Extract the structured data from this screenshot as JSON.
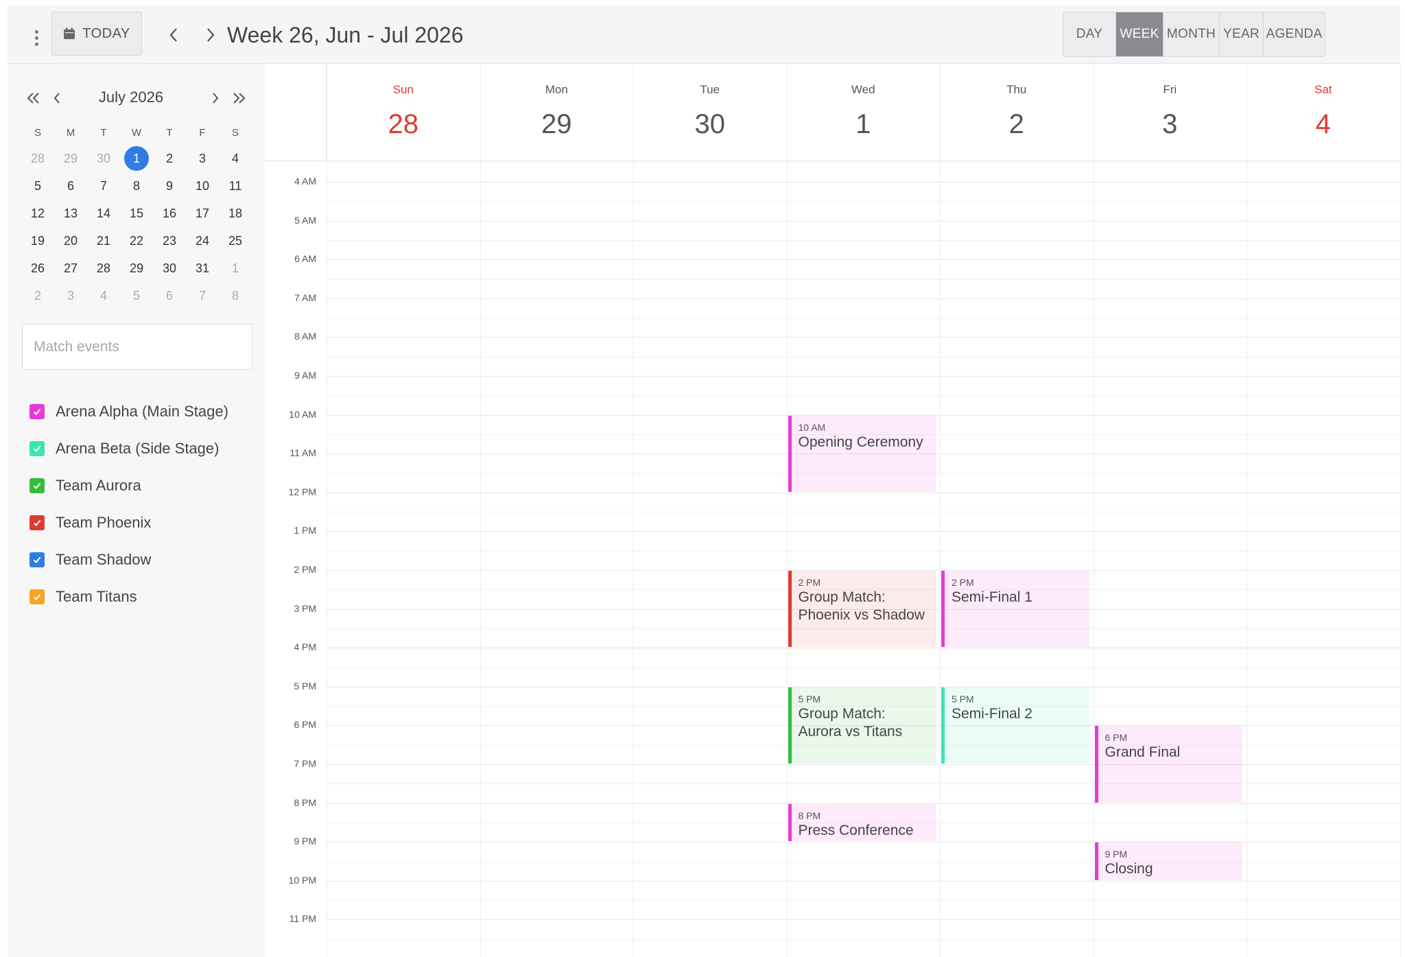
{
  "toolbar": {
    "today_label": "TODAY",
    "week_title": "Week 26, Jun - Jul 2026",
    "views": [
      "DAY",
      "WEEK",
      "MONTH",
      "YEAR",
      "AGENDA"
    ],
    "active_view": "WEEK"
  },
  "mini_calendar": {
    "title": "July 2026",
    "dow": [
      "S",
      "M",
      "T",
      "W",
      "T",
      "F",
      "S"
    ],
    "weeks": [
      [
        "28",
        "29",
        "30",
        "1",
        "2",
        "3",
        "4"
      ],
      [
        "5",
        "6",
        "7",
        "8",
        "9",
        "10",
        "11"
      ],
      [
        "12",
        "13",
        "14",
        "15",
        "16",
        "17",
        "18"
      ],
      [
        "19",
        "20",
        "21",
        "22",
        "23",
        "24",
        "25"
      ],
      [
        "26",
        "27",
        "28",
        "29",
        "30",
        "31",
        "1"
      ],
      [
        "2",
        "3",
        "4",
        "5",
        "6",
        "7",
        "8"
      ]
    ],
    "selected": "1"
  },
  "search": {
    "placeholder": "Match events"
  },
  "calendars": [
    {
      "name": "Arena Alpha (Main Stage)",
      "color": "#e83ad6"
    },
    {
      "name": "Arena Beta (Side Stage)",
      "color": "#3de3b0"
    },
    {
      "name": "Team Aurora",
      "color": "#2fbf3a"
    },
    {
      "name": "Team Phoenix",
      "color": "#e03a2f"
    },
    {
      "name": "Team Shadow",
      "color": "#2f7de1"
    },
    {
      "name": "Team Titans",
      "color": "#f5a623"
    }
  ],
  "days": [
    {
      "name": "Sun",
      "num": "28",
      "weekend": true
    },
    {
      "name": "Mon",
      "num": "29",
      "weekend": false
    },
    {
      "name": "Tue",
      "num": "30",
      "weekend": false
    },
    {
      "name": "Wed",
      "num": "1",
      "weekend": false
    },
    {
      "name": "Thu",
      "num": "2",
      "weekend": false
    },
    {
      "name": "Fri",
      "num": "3",
      "weekend": false
    },
    {
      "name": "Sat",
      "num": "4",
      "weekend": true
    }
  ],
  "hours": [
    "4 AM",
    "5 AM",
    "6 AM",
    "7 AM",
    "8 AM",
    "9 AM",
    "10 AM",
    "11 AM",
    "12 PM",
    "1 PM",
    "2 PM",
    "3 PM",
    "4 PM",
    "5 PM",
    "6 PM",
    "7 PM",
    "8 PM",
    "9 PM",
    "10 PM",
    "11 PM"
  ],
  "events": [
    {
      "day": 3,
      "start": 10,
      "end": 12,
      "time": "10 AM",
      "title": "Opening Ceremony",
      "calendar": 0
    },
    {
      "day": 3,
      "start": 14,
      "end": 16,
      "time": "2 PM",
      "title": "Group Match: Phoenix vs Shadow",
      "calendar": 3
    },
    {
      "day": 4,
      "start": 14,
      "end": 16,
      "time": "2 PM",
      "title": "Semi-Final 1",
      "calendar": 0
    },
    {
      "day": 3,
      "start": 17,
      "end": 19,
      "time": "5 PM",
      "title": "Group Match: Aurora vs Titans",
      "calendar": 2
    },
    {
      "day": 4,
      "start": 17,
      "end": 19,
      "time": "5 PM",
      "title": "Semi-Final 2",
      "calendar": 1
    },
    {
      "day": 5,
      "start": 18,
      "end": 20,
      "time": "6 PM",
      "title": "Grand Final",
      "calendar": 0
    },
    {
      "day": 3,
      "start": 20,
      "end": 21,
      "time": "8 PM",
      "title": "Press Conference",
      "calendar": 0
    },
    {
      "day": 5,
      "start": 21,
      "end": 22,
      "time": "9 PM",
      "title": "Closing",
      "calendar": 0
    }
  ]
}
